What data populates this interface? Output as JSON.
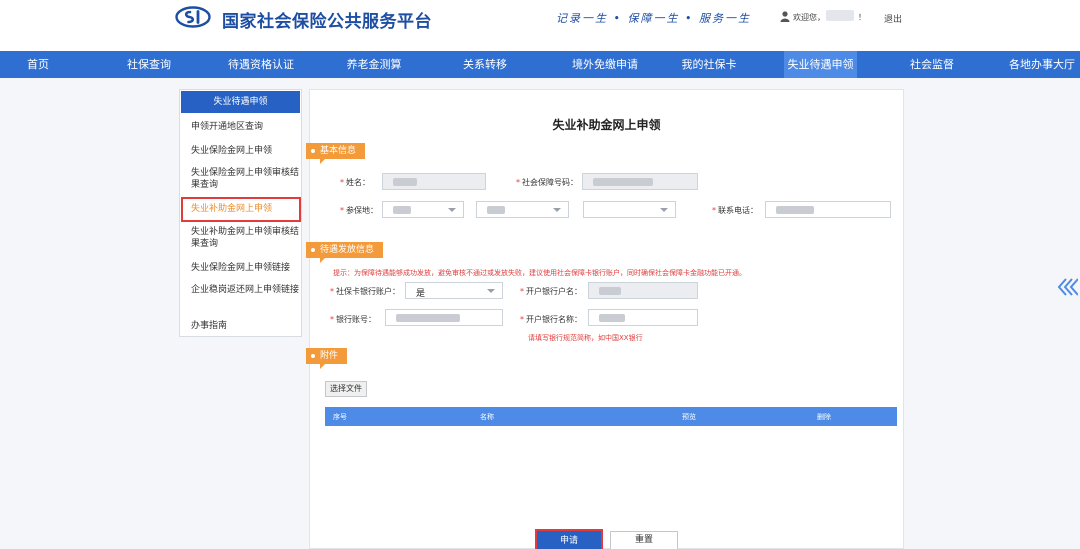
{
  "header": {
    "site_title": "国家社会保险公共服务平台",
    "slogan": "记录一生 • 保障一生 • 服务一生",
    "welcome": "欢迎您，",
    "exclaim": "！",
    "logout": "退出",
    "brand_color": "#1d4ea3"
  },
  "nav": {
    "items": [
      {
        "label": "首页"
      },
      {
        "label": "社保查询"
      },
      {
        "label": "待遇资格认证"
      },
      {
        "label": "养老金测算"
      },
      {
        "label": "关系转移"
      },
      {
        "label": "境外免缴申请"
      },
      {
        "label": "我的社保卡"
      },
      {
        "label": "失业待遇申领"
      },
      {
        "label": "社会监督"
      },
      {
        "label": "各地办事大厅"
      }
    ],
    "active_index": 7,
    "color": "#2f6fd2"
  },
  "sidebar": {
    "title": "失业待遇申领",
    "items": [
      {
        "label": "申领开通地区查询"
      },
      {
        "label": "失业保险金网上申领"
      },
      {
        "label": "失业保险金网上申领审核结果查询"
      },
      {
        "label": "失业补助金网上申领"
      },
      {
        "label": "失业补助金网上申领审核结果查询"
      },
      {
        "label": "失业保险金网上申领链接"
      },
      {
        "label": "企业稳岗返还网上申领链接"
      },
      {
        "label": "办事指南"
      }
    ],
    "active_index": 3
  },
  "form": {
    "title": "失业补助金网上申领",
    "sections": {
      "basic": "基本信息",
      "payment": "待遇发放信息",
      "attachment": "附件"
    },
    "labels": {
      "name": "姓名：",
      "ss_number": "社会保障号码：",
      "insured_place": "参保地：",
      "phone": "联系电话：",
      "ss_card_account": "社保卡银行账户：",
      "account_holder": "开户银行户名：",
      "bank_account": "银行账号：",
      "bank_name": "开户银行名称："
    },
    "ss_card_account_value": "是",
    "tip": "提示：为保障待遇能够成功发放，避免审核不通过或发放失败，建议使用社会保障卡银行账户，同时确保社会保障卡金融功能已开通。",
    "bank_name_note": "请填写银行规范简称，如中国XX银行",
    "choose_file": "选择文件",
    "file_table_columns": [
      "序号",
      "名称",
      "预览",
      "删除"
    ],
    "apply": "申请",
    "reset": "重置",
    "accent_color": "#f39a3b"
  }
}
